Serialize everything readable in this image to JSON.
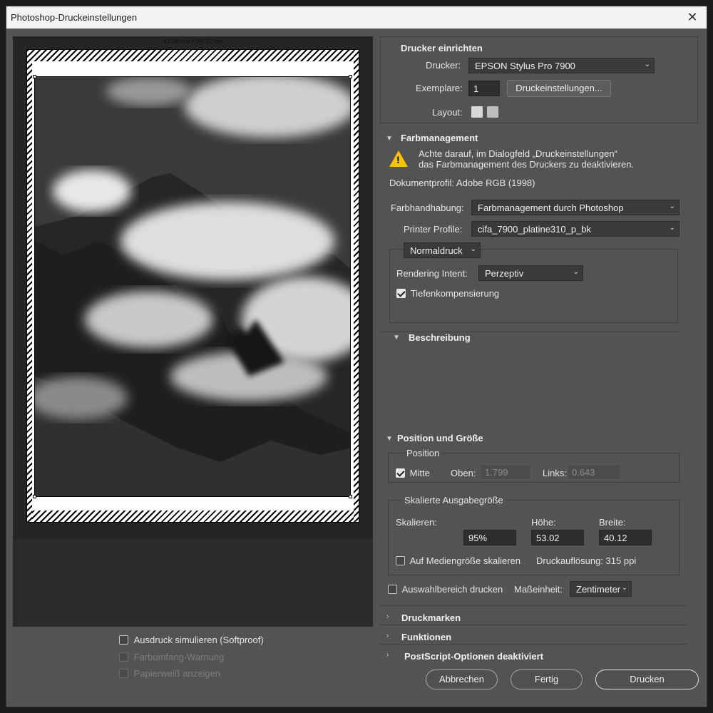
{
  "window": {
    "title": "Photoshop-Druckeinstellungen"
  },
  "preview": {
    "dimensions": "41.98 cm x 59.37 cm",
    "softproof_label": "Ausdruck simulieren (Softproof)",
    "gamut_label": "Farbumfang-Warnung",
    "paperwhite_label": "Papierweiß anzeigen"
  },
  "printer_setup": {
    "header": "Drucker einrichten",
    "printer_label": "Drucker:",
    "printer_value": "EPSON Stylus Pro 7900",
    "copies_label": "Exemplare:",
    "copies_value": "1",
    "print_settings_button": "Druckeinstellungen...",
    "layout_label": "Layout:"
  },
  "color_management": {
    "header": "Farbmanagement",
    "warning_line1": "Achte darauf, im Dialogfeld „Druckeinstellungen“",
    "warning_line2": "das Farbmanagement des Druckers zu deaktivieren.",
    "document_profile": "Dokumentprofil: Adobe RGB (1998)",
    "handling_label": "Farbhandhabung:",
    "handling_value": "Farbmanagement durch Photoshop",
    "printer_profile_label": "Printer Profile:",
    "printer_profile_value": "cifa_7900_platine310_p_bk",
    "mode_value": "Normaldruck",
    "rendering_intent_label": "Rendering Intent:",
    "rendering_intent_value": "Perzeptiv",
    "black_point_label": "Tiefenkompensierung"
  },
  "description": {
    "header": "Beschreibung"
  },
  "position_size": {
    "header": "Position und Größe",
    "position_group": "Position",
    "center_label": "Mitte",
    "top_label": "Oben:",
    "top_value": "1.799",
    "left_label": "Links:",
    "left_value": "0.643",
    "scaled_group": "Skalierte Ausgabegröße",
    "scale_label": "Skalieren:",
    "scale_value": "95%",
    "height_label": "Höhe:",
    "height_value": "53.02",
    "width_label": "Breite:",
    "width_value": "40.12",
    "fit_media_label": "Auf Mediengröße skalieren",
    "resolution": "Druckauflösung: 315 ppi",
    "print_selection_label": "Auswahlbereich drucken",
    "unit_label": "Maßeinheit:",
    "unit_value": "Zentimeter"
  },
  "collapsed_sections": {
    "marks": "Druckmarken",
    "functions": "Funktionen",
    "postscript": "PostScript-Optionen deaktiviert"
  },
  "buttons": {
    "cancel": "Abbrechen",
    "done": "Fertig",
    "print": "Drucken"
  }
}
